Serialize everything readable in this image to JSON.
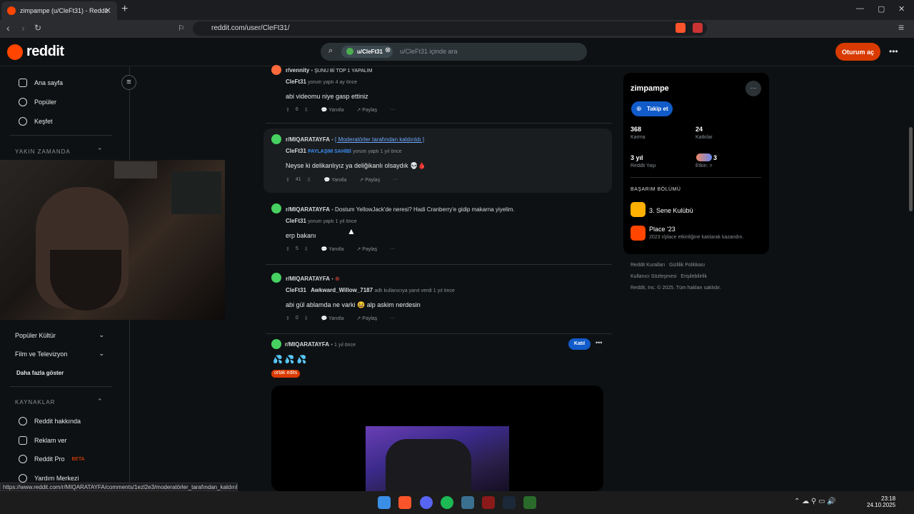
{
  "browser": {
    "tab_title": "zimpampe (u/CleFt31) - Reddit",
    "url": "reddit.com/user/CleFt31/",
    "status_url": "https://www.reddit.com/r/MIQARATAYFA/comments/1ezl2e3/moderatörler_tarafından_kaldırıl"
  },
  "header": {
    "logo": "reddit",
    "search_chip": "u/CleFt31",
    "search_placeholder": "u/CleFt31 içinde ara",
    "login": "Oturum aç"
  },
  "sidebar": {
    "nav": [
      "Ana sayfa",
      "Popüler",
      "Keşfet"
    ],
    "recent_heading": "YAKIN ZAMANDA",
    "topics": [
      "Popüler Kültür",
      "Film ve Televizyon"
    ],
    "show_more": "Daha fazla göster",
    "resources_heading": "KAYNAKLAR",
    "resources": [
      "Reddit hakkında",
      "Reklam ver",
      "Reddit Pro",
      "Yardım Merkezi"
    ],
    "beta": "BETA"
  },
  "posts": [
    {
      "sub": "r/vennity",
      "title": "ŞUNU Bİ TOP 1 YAPALIM",
      "user": "CleFt31",
      "meta": "yorum yaptı 4 ay önce",
      "body": "abi videomu niye gasp ettiniz",
      "votes": "6"
    },
    {
      "sub": "r/MIQARATAYFA",
      "title": "[ Moderatörler tarafından kaldırıldı ]",
      "user": "CleFt31",
      "badge": "PAYLAŞIM SAHİBİ",
      "meta": "yorum yaptı 1 yıl önce",
      "body": "Neyse ki delikanlıyız ya deliğikanlı olsaydık 💀🩸",
      "votes": "41"
    },
    {
      "sub": "r/MIQARATAYFA",
      "title": "Dostum YellowJack'de neresi? Hadi Cranberry'e gidip makarna yiyelim.",
      "user": "CleFt31",
      "meta": "yorum yaptı 1 yıl önce",
      "body": "erp bakanı",
      "votes": "5"
    },
    {
      "sub": "r/MIQARATAYFA",
      "title": "",
      "user": "CleFt31",
      "reply_to": "Awkward_Willow_7187",
      "meta": "adlı kullanıcıya yanıt verdi 1 yıl önce",
      "body": "abi gül ablamda ne varki 😆 alp askim nerdesin",
      "votes": "0"
    }
  ],
  "actions": {
    "reply": "Yanıtla",
    "share": "Paylaş",
    "more": "···"
  },
  "post5": {
    "sub": "r/MIQARATAYFA",
    "meta": "1 yıl önce",
    "join": "Katıl",
    "body": "💦 💦 💦",
    "flair": "ortak edits"
  },
  "profile": {
    "name": "zimpampe",
    "follow": "Takip et",
    "karma": "368",
    "karma_label": "Karma",
    "contrib": "24",
    "contrib_label": "Katkılar",
    "age": "3 yıl",
    "age_label": "Reddit Yaşı",
    "active": "3",
    "active_label": "Etkin: >",
    "achievements_heading": "BAŞARIM BÖLÜMÜ",
    "ach1": "3. Sene Kulübü",
    "ach2": "Place '23",
    "ach2_desc": "2023 r/place etkinliğine katılarak kazandın."
  },
  "footer": {
    "links1": "Reddit Kuralları   Gizlilik Politikası",
    "links2": "Kullanıcı Sözleşmesi   Erişilebilirlik",
    "copyright": "Reddit, Inc. © 2025. Tüm hakları saklıdır."
  },
  "taskbar": {
    "time": "23:18",
    "date": "24.10.2025"
  }
}
